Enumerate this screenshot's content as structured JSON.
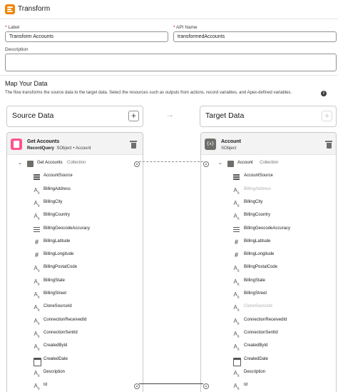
{
  "header": {
    "title": "Transform",
    "icon": "transform-icon"
  },
  "form": {
    "label": {
      "label": "Label",
      "required": "*",
      "value": "Transform Accounts"
    },
    "api_name": {
      "label": "API Name",
      "required": "*",
      "value": "transformedAccounts"
    },
    "description": {
      "label": "Description",
      "value": ""
    }
  },
  "map": {
    "title": "Map Your Data",
    "description": "The flow transforms the source data to the target data. Select the resources such as outputs from actions, record variables, and Apex-defined variables."
  },
  "source": {
    "card_title": "Source Data",
    "add_label": "+",
    "resource_name": "Get Accounts",
    "resource_type": "RecordQuery",
    "resource_kind": "SObject",
    "separator": "•",
    "resource_object": "Account",
    "root": {
      "label": "Get Accounts",
      "tag": "Collection"
    },
    "fields": [
      {
        "name": "AccountSource",
        "icon": "picklist"
      },
      {
        "name": "BillingAddress",
        "icon": "text"
      },
      {
        "name": "BillingCity",
        "icon": "text"
      },
      {
        "name": "BillingCountry",
        "icon": "text"
      },
      {
        "name": "BillingGeocodeAccuracy",
        "icon": "picklist"
      },
      {
        "name": "BillingLatitude",
        "icon": "number"
      },
      {
        "name": "BillingLongitude",
        "icon": "number"
      },
      {
        "name": "BillingPostalCode",
        "icon": "text"
      },
      {
        "name": "BillingState",
        "icon": "text"
      },
      {
        "name": "BillingStreet",
        "icon": "text"
      },
      {
        "name": "CloneSourceId",
        "icon": "text"
      },
      {
        "name": "ConnectionReceivedId",
        "icon": "text"
      },
      {
        "name": "ConnectionSentId",
        "icon": "text"
      },
      {
        "name": "CreatedById",
        "icon": "text"
      },
      {
        "name": "CreatedDate",
        "icon": "date"
      },
      {
        "name": "Description",
        "icon": "text"
      },
      {
        "name": "Id",
        "icon": "text"
      }
    ]
  },
  "target": {
    "card_title": "Target Data",
    "add_label": "+",
    "resource_name": "Account",
    "resource_kind": "SObject",
    "resource_icon_text": "{x}",
    "root": {
      "label": "Account",
      "tag": "Collection"
    },
    "fields": [
      {
        "name": "AccountSource",
        "icon": "picklist",
        "disabled": false
      },
      {
        "name": "BillingAddress",
        "icon": "text",
        "disabled": true
      },
      {
        "name": "BillingCity",
        "icon": "text",
        "disabled": false
      },
      {
        "name": "BillingCountry",
        "icon": "text",
        "disabled": false
      },
      {
        "name": "BillingGeocodeAccuracy",
        "icon": "picklist",
        "disabled": false
      },
      {
        "name": "BillingLatitude",
        "icon": "number",
        "disabled": false
      },
      {
        "name": "BillingLongitude",
        "icon": "number",
        "disabled": false
      },
      {
        "name": "BillingPostalCode",
        "icon": "text",
        "disabled": false
      },
      {
        "name": "BillingState",
        "icon": "text",
        "disabled": false
      },
      {
        "name": "BillingStreet",
        "icon": "text",
        "disabled": false
      },
      {
        "name": "CloneSourceId",
        "icon": "text",
        "disabled": true
      },
      {
        "name": "ConnectionReceivedId",
        "icon": "text",
        "disabled": false
      },
      {
        "name": "ConnectionSentId",
        "icon": "text",
        "disabled": false
      },
      {
        "name": "CreatedById",
        "icon": "text",
        "disabled": false
      },
      {
        "name": "CreatedDate",
        "icon": "date",
        "disabled": false
      },
      {
        "name": "Description",
        "icon": "text",
        "disabled": false
      },
      {
        "name": "Id",
        "icon": "text",
        "disabled": false
      }
    ]
  },
  "mappings": [
    {
      "from": "Get Accounts",
      "to": "Account",
      "style": "dashed"
    },
    {
      "from": "Id",
      "to": "Id",
      "style": "solid"
    }
  ]
}
